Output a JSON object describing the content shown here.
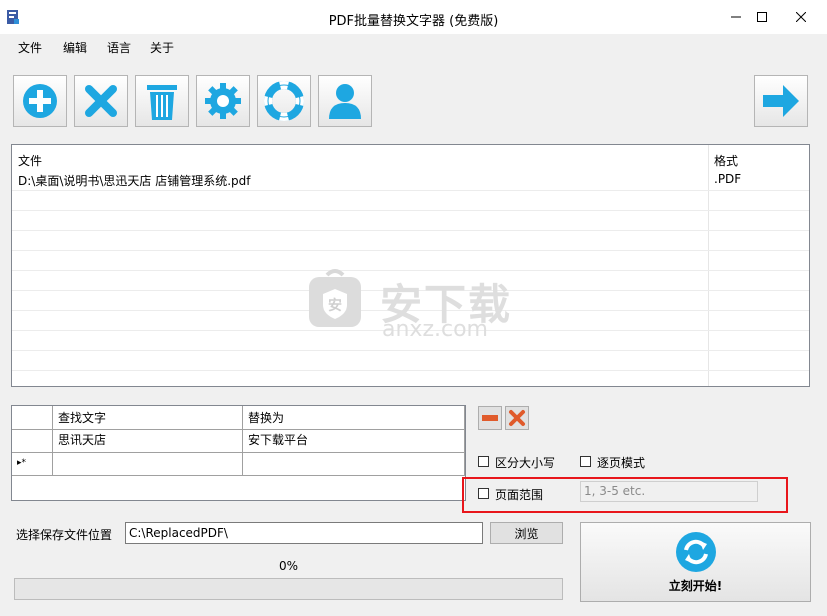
{
  "window": {
    "title": "PDF批量替换文字器 (免费版)"
  },
  "menu": [
    "文件",
    "编辑",
    "语言",
    "关于"
  ],
  "toolbar": {
    "icons": [
      "add-icon",
      "remove-icon",
      "trash-icon",
      "settings-icon",
      "help-lifebuoy-icon",
      "user-icon",
      "next-arrow-icon"
    ]
  },
  "file_list": {
    "columns": [
      "文件",
      "格式"
    ],
    "rows": [
      {
        "file": "D:\\桌面\\说明书\\思迅天店 店铺管理系统.pdf",
        "format": ".PDF"
      }
    ]
  },
  "replace_table": {
    "columns": [
      "查找文字",
      "替换为"
    ],
    "rows": [
      {
        "find": "思讯天店",
        "replace": "安下载平台"
      }
    ],
    "new_row_marker": "▸*"
  },
  "options": {
    "case_sensitive_label": "区分大小写",
    "page_mode_label": "逐页模式",
    "page_range_label": "页面范围",
    "page_range_placeholder": "1, 3-5 etc."
  },
  "save": {
    "label": "选择保存文件位置",
    "path": "C:\\ReplacedPDF\\",
    "browse_label": "浏览"
  },
  "progress": {
    "text": "0%",
    "value": 0
  },
  "start": {
    "label": "立刻开始!"
  },
  "watermark": {
    "text": "安下载",
    "sub": "anxz.com"
  },
  "colors": {
    "accent": "#1ea7e1",
    "highlight": "#e8161b",
    "delete_red": "#e05a2b"
  }
}
